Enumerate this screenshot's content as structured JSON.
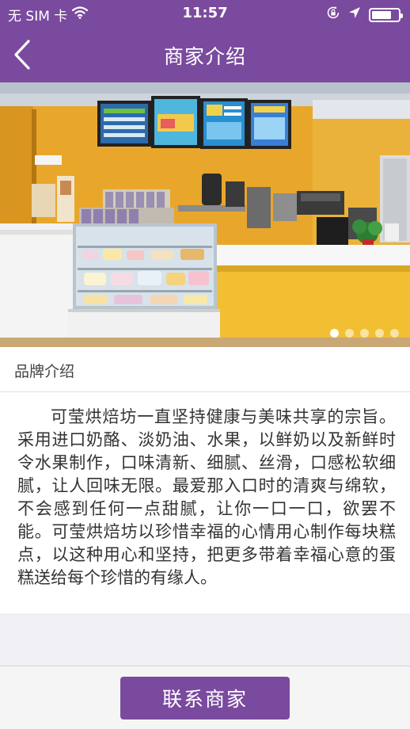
{
  "status_bar": {
    "carrier": "无 SIM 卡",
    "time": "11:57",
    "battery_level": 0.75
  },
  "nav": {
    "title": "商家介绍",
    "back_icon": "chevron-left-icon"
  },
  "carousel": {
    "image_description": "bakery store interior",
    "slide_count": 5,
    "active_index": 0
  },
  "brand": {
    "title": "品牌介绍",
    "description": "可莹烘焙坊一直坚持健康与美味共享的宗旨。采用进口奶酪、淡奶油、水果，以鲜奶以及新鲜时令水果制作，口味清新、细腻、丝滑，口感松软细腻，让人回味无限。最爱那入口时的清爽与绵软，不会感到任何一点甜腻，让你一口一口，欲罢不能。可莹烘焙坊以珍惜幸福的心情用心制作每块糕点，以这种用心和坚持，把更多带着幸福心意的蛋糕送给每个珍惜的有缘人。"
  },
  "footer": {
    "contact_label": "联系商家"
  },
  "colors": {
    "accent": "#7a4a9e",
    "background": "#efeff4"
  }
}
